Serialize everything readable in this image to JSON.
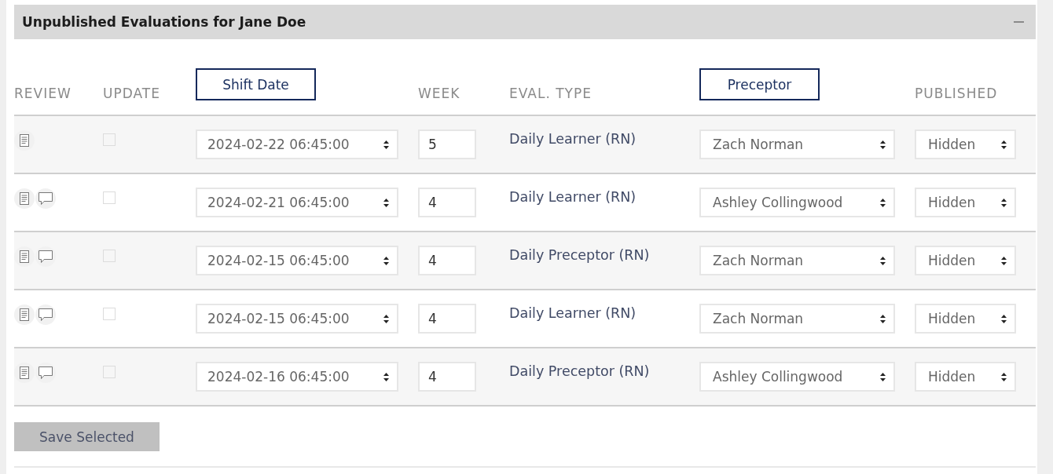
{
  "panel": {
    "title": "Unpublished Evaluations for Jane Doe"
  },
  "columns": [
    {
      "label": "REVIEW",
      "kind": "label"
    },
    {
      "label": "UPDATE",
      "kind": "label"
    },
    {
      "label": "Shift Date",
      "kind": "sort_button"
    },
    {
      "label": "WEEK",
      "kind": "label"
    },
    {
      "label": "EVAL. TYPE",
      "kind": "label"
    },
    {
      "label": "Preceptor",
      "kind": "sort_button"
    },
    {
      "label": "PUBLISHED",
      "kind": "label"
    }
  ],
  "rows": [
    {
      "has_comment": false,
      "update_checked": false,
      "shift_date": "2024-02-22 06:45:00",
      "week": "5",
      "eval_type": "Daily Learner (RN)",
      "preceptor": "Zach Norman",
      "published": "Hidden"
    },
    {
      "has_comment": true,
      "update_checked": false,
      "shift_date": "2024-02-21 06:45:00",
      "week": "4",
      "eval_type": "Daily Learner (RN)",
      "preceptor": "Ashley Collingwood",
      "published": "Hidden"
    },
    {
      "has_comment": true,
      "update_checked": false,
      "shift_date": "2024-02-15 06:45:00",
      "week": "4",
      "eval_type": "Daily Preceptor (RN)",
      "preceptor": "Zach Norman",
      "published": "Hidden"
    },
    {
      "has_comment": true,
      "update_checked": false,
      "shift_date": "2024-02-15 06:45:00",
      "week": "4",
      "eval_type": "Daily Learner (RN)",
      "preceptor": "Zach Norman",
      "published": "Hidden"
    },
    {
      "has_comment": true,
      "update_checked": false,
      "shift_date": "2024-02-16 06:45:00",
      "week": "4",
      "eval_type": "Daily Preceptor (RN)",
      "preceptor": "Ashley Collingwood",
      "published": "Hidden"
    }
  ],
  "save_button": {
    "label": "Save Selected"
  }
}
